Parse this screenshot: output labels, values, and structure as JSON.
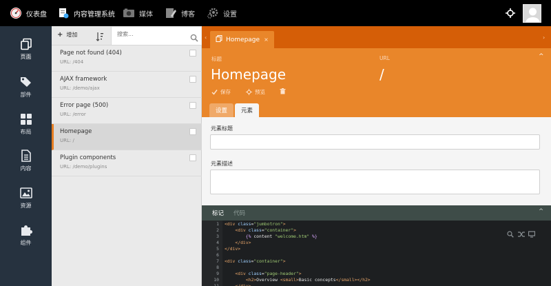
{
  "topnav": {
    "items": [
      {
        "label": "仪表盘",
        "icon": "dashboard-gauge-icon"
      },
      {
        "label": "内容管理系统",
        "icon": "cms-icon"
      },
      {
        "label": "媒体",
        "icon": "camera-icon"
      },
      {
        "label": "博客",
        "icon": "blog-pencil-icon"
      },
      {
        "label": "设置",
        "icon": "gear-icon"
      }
    ]
  },
  "sidebar": {
    "items": [
      {
        "label": "页面",
        "icon": "pages-icon"
      },
      {
        "label": "部件",
        "icon": "tag-icon"
      },
      {
        "label": "布局",
        "icon": "grid-icon"
      },
      {
        "label": "内容",
        "icon": "document-icon"
      },
      {
        "label": "资源",
        "icon": "image-icon"
      },
      {
        "label": "组件",
        "icon": "puzzle-icon"
      }
    ]
  },
  "list": {
    "add_label": "增加",
    "search_placeholder": "搜索...",
    "items": [
      {
        "title": "Page not found (404)",
        "url": "URL: /404",
        "selected": false
      },
      {
        "title": "AJAX framework",
        "url": "URL: /demo/ajax",
        "selected": false
      },
      {
        "title": "Error page (500)",
        "url": "URL: /error",
        "selected": false
      },
      {
        "title": "Homepage",
        "url": "URL: /",
        "selected": true
      },
      {
        "title": "Plugin components",
        "url": "URL: /demo/plugins",
        "selected": false
      }
    ]
  },
  "editor_tab": {
    "label": "Homepage",
    "close": "×"
  },
  "header": {
    "title_label": "标题",
    "title_value": "Homepage",
    "url_label": "URL",
    "url_value": "/",
    "actions": {
      "save": "保存",
      "preview": "预览"
    },
    "collapse": "^"
  },
  "inner_tabs": {
    "settings": "设置",
    "elements": "元素"
  },
  "form": {
    "element_title_label": "元素标题",
    "element_title_value": "",
    "element_desc_label": "元素描述",
    "element_desc_value": ""
  },
  "code_editor": {
    "tab_markup": "标记",
    "tab_code": "代码"
  },
  "colors": {
    "topbar": "#000000",
    "sidebar": "#26323f",
    "accent_orange": "#e9862a",
    "tabstrip_orange": "#d55e07",
    "editor_bg": "#1d1f21"
  }
}
